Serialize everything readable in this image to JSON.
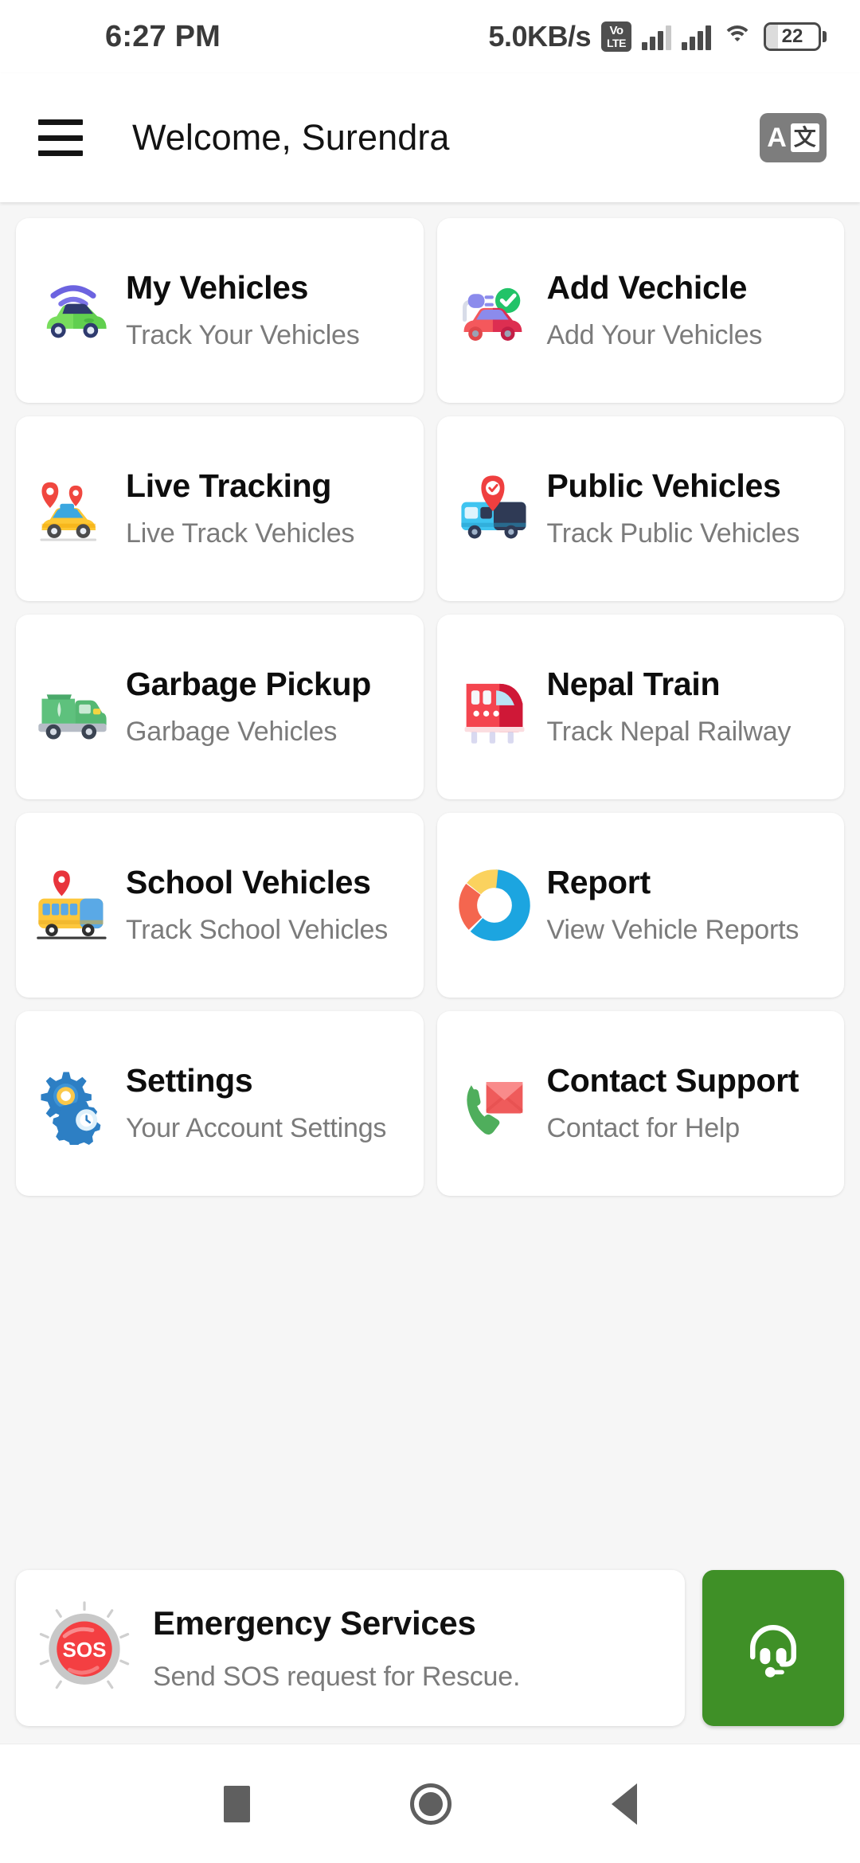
{
  "status_bar": {
    "time": "6:27 PM",
    "net_speed": "5.0KB/s",
    "volte_top": "Vo",
    "volte_bottom": "LTE",
    "battery_percent": "22",
    "icons": [
      "volte-icon",
      "signal-bars-sim1-icon",
      "signal-bars-sim2-icon",
      "wifi-icon",
      "battery-icon"
    ]
  },
  "app_bar": {
    "menu_icon": "hamburger-menu-icon",
    "title": "Welcome, Surendra",
    "translate_letter": "A",
    "translate_glyph": "文",
    "translate_icon": "translate-icon"
  },
  "grid": {
    "cards": [
      {
        "title": "My Vehicles",
        "subtitle": "Track Your Vehicles",
        "icon": "connected-green-car-icon"
      },
      {
        "title": "Add Vechicle",
        "subtitle": "Add Your Vehicles",
        "icon": "add-red-car-plug-check-icon"
      },
      {
        "title": "Live Tracking",
        "subtitle": "Live Track Vehicles",
        "icon": "taxi-map-pins-icon"
      },
      {
        "title": "Public Vehicles",
        "subtitle": "Track Public Vehicles",
        "icon": "blue-bus-pin-icon"
      },
      {
        "title": "Garbage Pickup",
        "subtitle": "Garbage Vehicles",
        "icon": "green-garbage-truck-icon"
      },
      {
        "title": "Nepal Train",
        "subtitle": "Track Nepal Railway",
        "icon": "red-train-icon"
      },
      {
        "title": "School Vehicles",
        "subtitle": "Track School Vehicles",
        "icon": "yellow-school-bus-pin-icon"
      },
      {
        "title": "Report",
        "subtitle": "View Vehicle Reports",
        "icon": "donut-chart-icon"
      },
      {
        "title": "Settings",
        "subtitle": "Your Account Settings",
        "icon": "blue-gears-icon"
      },
      {
        "title": "Contact Support",
        "subtitle": "Contact for Help",
        "icon": "phone-envelope-icon"
      }
    ]
  },
  "emergency": {
    "sos_label": "SOS",
    "title": "Emergency Services",
    "subtitle": "Send SOS request for Rescue.",
    "sos_icon": "sos-button-icon",
    "support_icon": "headset-support-icon",
    "support_button_color": "#3f9027"
  },
  "nav_bar": {
    "recents_icon": "recents-square-icon",
    "home_icon": "home-circle-icon",
    "back_icon": "back-triangle-icon"
  },
  "colors": {
    "background": "#f6f6f6",
    "card": "#ffffff",
    "title_text": "#0d0d0d",
    "subtitle_text": "#7b7b7b",
    "accent_green": "#3f9027",
    "sos_red": "#f43f42"
  }
}
